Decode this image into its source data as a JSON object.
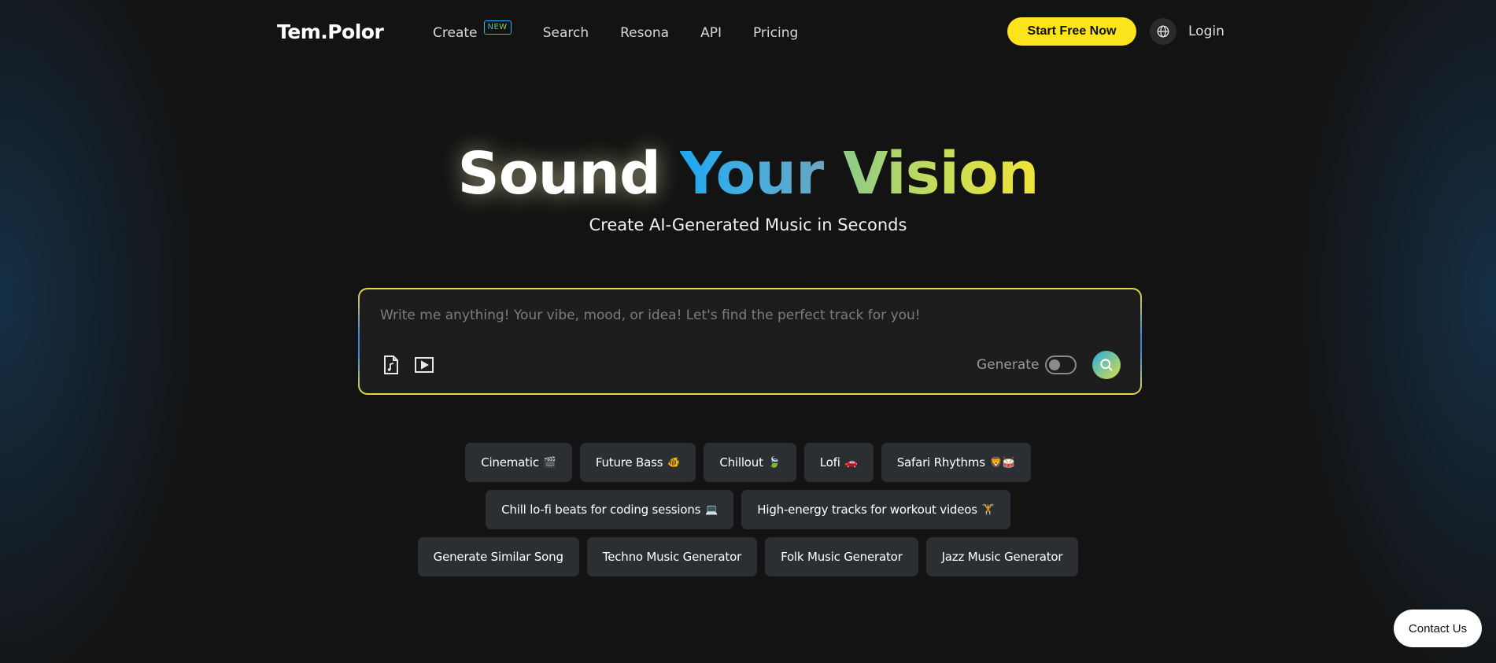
{
  "header": {
    "logo": "Tem.Polor",
    "nav": [
      {
        "label": "Create",
        "badge": "NEW"
      },
      {
        "label": "Search"
      },
      {
        "label": "Resona"
      },
      {
        "label": "API"
      },
      {
        "label": "Pricing"
      }
    ],
    "start_button": "Start Free Now",
    "globe_icon": "globe-icon",
    "login": "Login"
  },
  "hero": {
    "title_word1": "Sound",
    "title_word2": "Your",
    "title_word3": "Vision",
    "subtitle": "Create AI-Generated Music in Seconds"
  },
  "search": {
    "placeholder": "Write me anything! Your vibe, mood, or idea! Let's find the perfect track for you!",
    "value": "",
    "tools": [
      "music-file-icon",
      "video-play-icon"
    ],
    "generate_label": "Generate",
    "generate_enabled": false,
    "search_icon": "search-icon"
  },
  "chips": {
    "row1": [
      {
        "label": "Cinematic",
        "emoji": "🎬"
      },
      {
        "label": "Future Bass",
        "emoji": "🐠"
      },
      {
        "label": "Chillout",
        "emoji": "🍃"
      },
      {
        "label": "Lofi",
        "emoji": "🚗"
      },
      {
        "label": "Safari Rhythms",
        "emoji": "🦁🥁"
      }
    ],
    "row2": [
      {
        "label": "Chill lo-fi beats for coding sessions",
        "emoji": "💻"
      },
      {
        "label": "High-energy tracks for workout videos",
        "emoji": "🏋"
      }
    ],
    "row3": [
      {
        "label": "Generate Similar Song",
        "emoji": ""
      },
      {
        "label": "Techno Music Generator",
        "emoji": ""
      },
      {
        "label": "Folk Music Generator",
        "emoji": ""
      },
      {
        "label": "Jazz Music Generator",
        "emoji": ""
      }
    ]
  },
  "contact": "Contact Us",
  "colors": {
    "background": "#131313",
    "accent_yellow": "#fbe41b",
    "accent_blue": "#1ea7f0",
    "chip_bg": "#2b2f33"
  }
}
